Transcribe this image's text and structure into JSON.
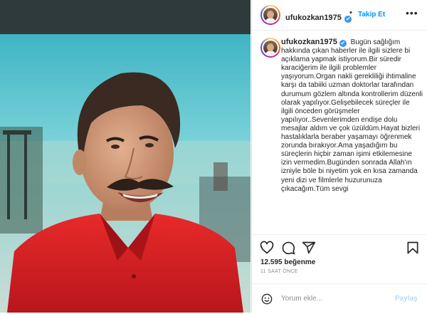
{
  "post": {
    "username": "ufukozkan1975",
    "verified_mark": "✔",
    "separator": "•",
    "follow_label": "Takip Et",
    "more_label": "•••",
    "caption_username": "ufukozkan1975",
    "caption_verified_mark": "✔",
    "caption_text": "Bugün sağlığım hakkında çıkan haberler ile ilgili sizlere bi açıklama yapmak istiyorum.Bir süredir karaciğerim ile ilgili problemler yaşıyorum.Organ nakli gerekliliği ihtimaline karşı da tabiiki uzman doktorlar tarafından durumum gözlem altında kontrollerim düzenli olarak yapılıyor.Gelişebilecek süreçler ile ilgili önceden görüşmeler yapılıyor..Sevenlerimden endişe dolu mesajlar aldım ve çok üzüldüm.Hayat bizleri hastalıklarla beraber yaşamayı öğrenmek zorunda bırakıyor.Ama yaşadığım bu süreçlerin hiçbir zaman işimi etkilemesine izin vermedim.Bugünden sonrada Allah'ın izniyle böle bi niyetim yok en kısa zamanda yeni dizi ve filmlerle huzurunuza çıkacağım.Tüm sevgi",
    "likes": "12.595 beğenme",
    "time_ago": "11 SAAT ÖNCE",
    "comment_placeholder": "Yorum ekle...",
    "post_label": "Paylaş"
  },
  "icons": {
    "like": "heart-icon",
    "comment": "comment-icon",
    "share": "send-icon",
    "save": "bookmark-icon",
    "emoji": "emoji-icon"
  },
  "colors": {
    "link_blue": "#0095f6",
    "verified_blue": "#3897f0",
    "disabled_blue": "#b3dbff",
    "muted_gray": "#8e8e8e"
  }
}
